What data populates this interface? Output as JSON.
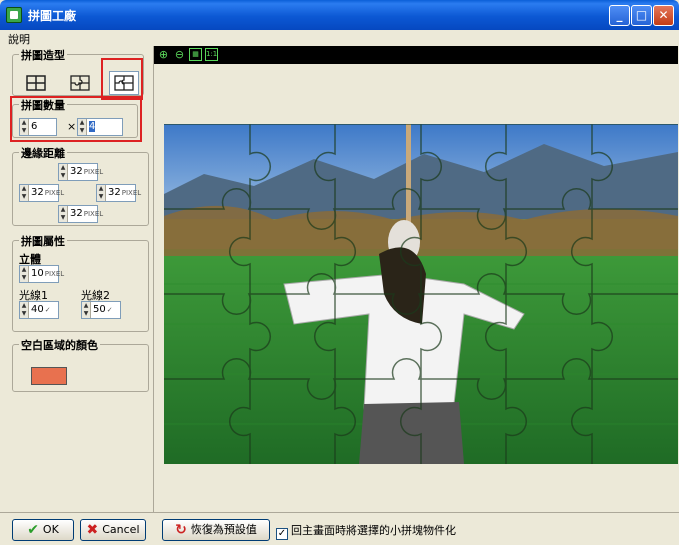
{
  "window": {
    "title": "拼圖工廠",
    "controls": {
      "minimize": "_",
      "maximize": "□",
      "close": "✕"
    }
  },
  "menu": {
    "items": [
      "說明"
    ]
  },
  "shape_group": {
    "label": "拼圖造型",
    "options": [
      "grid-shape",
      "puzzle-shape",
      "puzzle-shape-alt"
    ],
    "selected": 2
  },
  "count_group": {
    "label": "拼圖數量",
    "columns": "6",
    "times": "×",
    "rows": "4"
  },
  "margin_group": {
    "label": "邊緣距離",
    "unit": "PIXEL",
    "top": "32",
    "left": "32",
    "right": "32",
    "bottom": "32"
  },
  "attr_group": {
    "label": "拼圖屬性",
    "depth_label": "立體",
    "depth_value": "10",
    "depth_unit": "PIXEL",
    "light1_label": "光線1",
    "light1_value": "40",
    "light2_label": "光線2",
    "light2_value": "50"
  },
  "bg_group": {
    "label": "空白區域的顏色",
    "color": "#e8714f"
  },
  "viewer_toolbar": {
    "icons": [
      "zoom-in-icon",
      "zoom-out-icon",
      "fit-icon",
      "actual-size-icon"
    ],
    "actual_size_text": "1:1"
  },
  "bottom": {
    "ok_label": "OK",
    "cancel_label": "Cancel",
    "reset_label": "恢復為預設值",
    "checkbox_label": "回主畫面時將選擇的小拼塊物件化",
    "checkbox_checked": true
  },
  "colors": {
    "titlebar": "#0a5fd8",
    "highlight_box": "#dd2222",
    "swatch": "#e8714f"
  }
}
